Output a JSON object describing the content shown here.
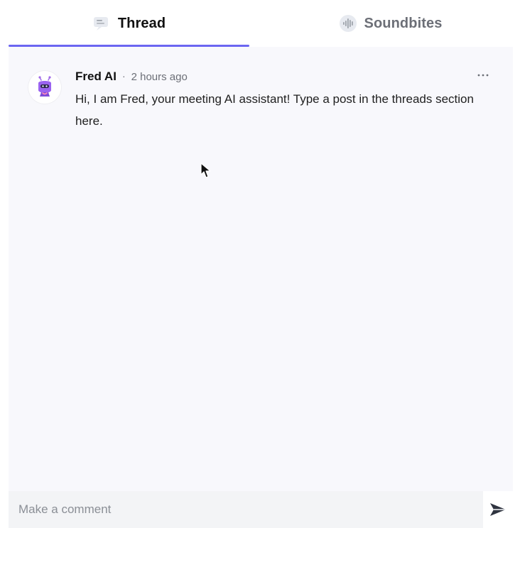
{
  "tabs": [
    {
      "label": "Thread",
      "active": true,
      "icon": "thread-icon"
    },
    {
      "label": "Soundbites",
      "active": false,
      "icon": "soundbites-icon"
    }
  ],
  "post": {
    "author": "Fred AI",
    "separator": "·",
    "timestamp": "2 hours ago",
    "message": "Hi, I am Fred, your meeting AI assistant! Type a post in the threads section here.",
    "avatar_icon": "fred-ai-avatar"
  },
  "comment": {
    "placeholder": "Make a comment",
    "send_icon": "send-icon"
  },
  "colors": {
    "accent": "#6b66f1",
    "panel_background": "#f8f8fc",
    "text_primary": "#111111",
    "text_secondary": "#6c6f77",
    "input_background": "#f3f4f6"
  }
}
